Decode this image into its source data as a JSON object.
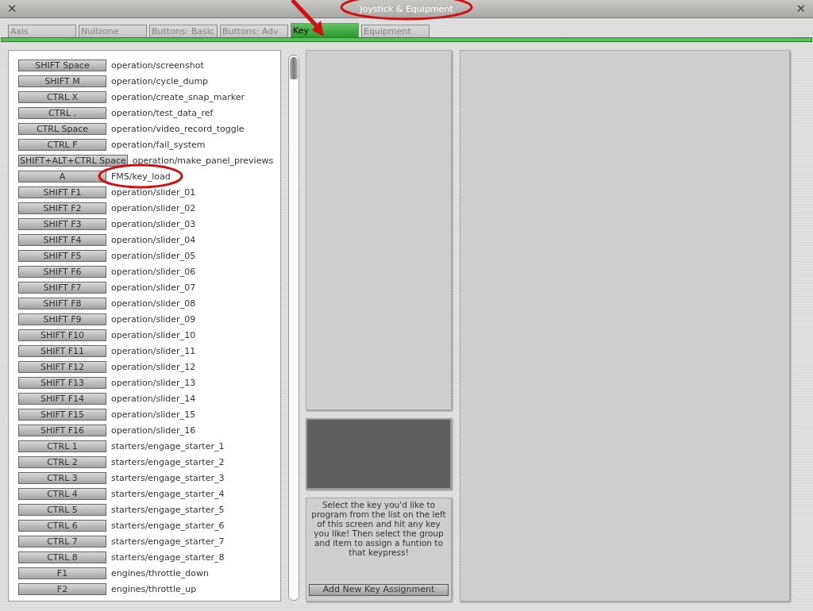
{
  "window": {
    "title": "Joystick & Equipment",
    "close_left": "✕",
    "close_right": "✕"
  },
  "tabs": [
    {
      "label": "Axis",
      "selected": false
    },
    {
      "label": "Nullzone",
      "selected": false
    },
    {
      "label": "Buttons: Basic",
      "selected": false
    },
    {
      "label": "Buttons: Adv",
      "selected": false
    },
    {
      "label": "Key",
      "selected": true
    },
    {
      "label": "Equipment",
      "selected": false
    }
  ],
  "key_list": [
    {
      "key": "SHIFT Space",
      "command": "operation/screenshot"
    },
    {
      "key": "SHIFT M",
      "command": "operation/cycle_dump"
    },
    {
      "key": "CTRL X",
      "command": "operation/create_snap_marker"
    },
    {
      "key": "CTRL ,",
      "command": "operation/test_data_ref"
    },
    {
      "key": "CTRL Space",
      "command": "operation/video_record_toggle"
    },
    {
      "key": "CTRL F",
      "command": "operation/fail_system"
    },
    {
      "key": "SHIFT+ALT+CTRL Space",
      "command": "operation/make_panel_previews"
    },
    {
      "key": "A",
      "command": "FMS/key_load"
    },
    {
      "key": "SHIFT F1",
      "command": "operation/slider_01"
    },
    {
      "key": "SHIFT F2",
      "command": "operation/slider_02"
    },
    {
      "key": "SHIFT F3",
      "command": "operation/slider_03"
    },
    {
      "key": "SHIFT F4",
      "command": "operation/slider_04"
    },
    {
      "key": "SHIFT F5",
      "command": "operation/slider_05"
    },
    {
      "key": "SHIFT F6",
      "command": "operation/slider_06"
    },
    {
      "key": "SHIFT F7",
      "command": "operation/slider_07"
    },
    {
      "key": "SHIFT F8",
      "command": "operation/slider_08"
    },
    {
      "key": "SHIFT F9",
      "command": "operation/slider_09"
    },
    {
      "key": "SHIFT F10",
      "command": "operation/slider_10"
    },
    {
      "key": "SHIFT F11",
      "command": "operation/slider_11"
    },
    {
      "key": "SHIFT F12",
      "command": "operation/slider_12"
    },
    {
      "key": "SHIFT F13",
      "command": "operation/slider_13"
    },
    {
      "key": "SHIFT F14",
      "command": "operation/slider_14"
    },
    {
      "key": "SHIFT F15",
      "command": "operation/slider_15"
    },
    {
      "key": "SHIFT F16",
      "command": "operation/slider_16"
    },
    {
      "key": "CTRL 1",
      "command": "starters/engage_starter_1"
    },
    {
      "key": "CTRL 2",
      "command": "starters/engage_starter_2"
    },
    {
      "key": "CTRL 3",
      "command": "starters/engage_starter_3"
    },
    {
      "key": "CTRL 4",
      "command": "starters/engage_starter_4"
    },
    {
      "key": "CTRL 5",
      "command": "starters/engage_starter_5"
    },
    {
      "key": "CTRL 6",
      "command": "starters/engage_starter_6"
    },
    {
      "key": "CTRL 7",
      "command": "starters/engage_starter_7"
    },
    {
      "key": "CTRL 8",
      "command": "starters/engage_starter_8"
    },
    {
      "key": "F1",
      "command": "engines/throttle_down"
    },
    {
      "key": "F2",
      "command": "engines/throttle_up"
    }
  ],
  "help_text": "Select the key you'd like to program from the list on the left of this screen and hit any key you like! Then select the group and item to assign a funtion to that keypress!",
  "add_button": "Add New Key Assignment"
}
